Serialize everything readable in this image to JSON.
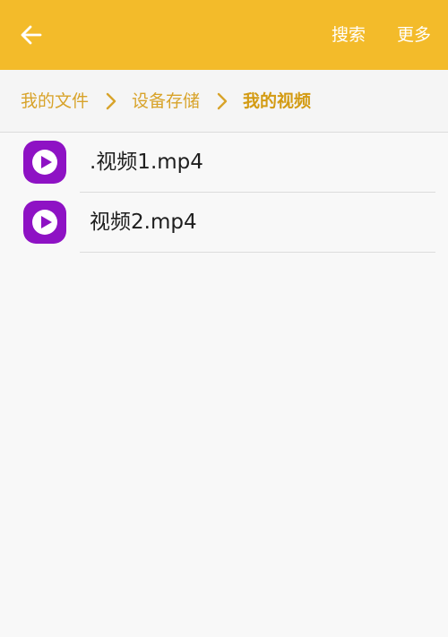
{
  "colors": {
    "accent": "#f3bb2a",
    "breadcrumb_text": "#d8a32a",
    "video_icon": "#8e12c4"
  },
  "appbar": {
    "back_icon": "arrow-left-icon",
    "search_label": "搜索",
    "more_label": "更多"
  },
  "breadcrumb": {
    "items": [
      {
        "label": "我的文件"
      },
      {
        "label": "设备存储"
      },
      {
        "label": "我的视频"
      }
    ],
    "separator_icon": "chevron-right-icon"
  },
  "files": [
    {
      "name": ".视频1.mp4",
      "icon": "video-play-icon"
    },
    {
      "name": "视频2.mp4",
      "icon": "video-play-icon"
    }
  ]
}
